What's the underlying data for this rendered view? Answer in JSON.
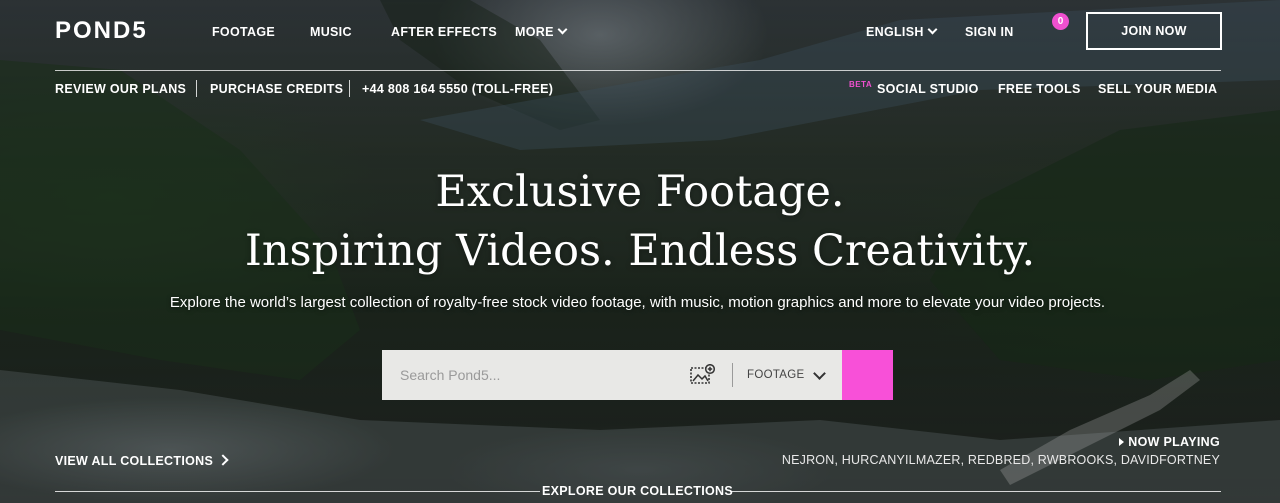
{
  "brand": {
    "logo": "POND5",
    "accent": "#f850d8"
  },
  "nav": {
    "footage": "FOOTAGE",
    "music": "MUSIC",
    "after_effects": "AFTER EFFECTS",
    "more": "MORE",
    "language": "ENGLISH",
    "sign_in": "SIGN IN",
    "cart_count": "0",
    "join": "JOIN NOW"
  },
  "subnav": {
    "review_plans": "REVIEW OUR PLANS",
    "purchase_credits": "PURCHASE CREDITS",
    "phone": "+44 808 164 5550 (TOLL-FREE)",
    "beta": "BETA",
    "social_studio": "SOCIAL STUDIO",
    "free_tools": "FREE TOOLS",
    "sell_media": "SELL YOUR MEDIA"
  },
  "hero": {
    "headline_line1": "Exclusive Footage.",
    "headline_line2": "Inspiring Videos. Endless Creativity.",
    "subtitle": "Explore the world’s largest collection of royalty-free stock video footage, with music, motion graphics and more to elevate your video projects."
  },
  "search": {
    "placeholder": "Search Pond5...",
    "media_type": "FOOTAGE"
  },
  "footer": {
    "view_all": "VIEW ALL COLLECTIONS",
    "now_playing": "NOW PLAYING",
    "artists": "NEJRON, HURCANYILMAZER, REDBRED, RWBROOKS, DAVIDFORTNEY",
    "explore": "EXPLORE OUR COLLECTIONS"
  }
}
